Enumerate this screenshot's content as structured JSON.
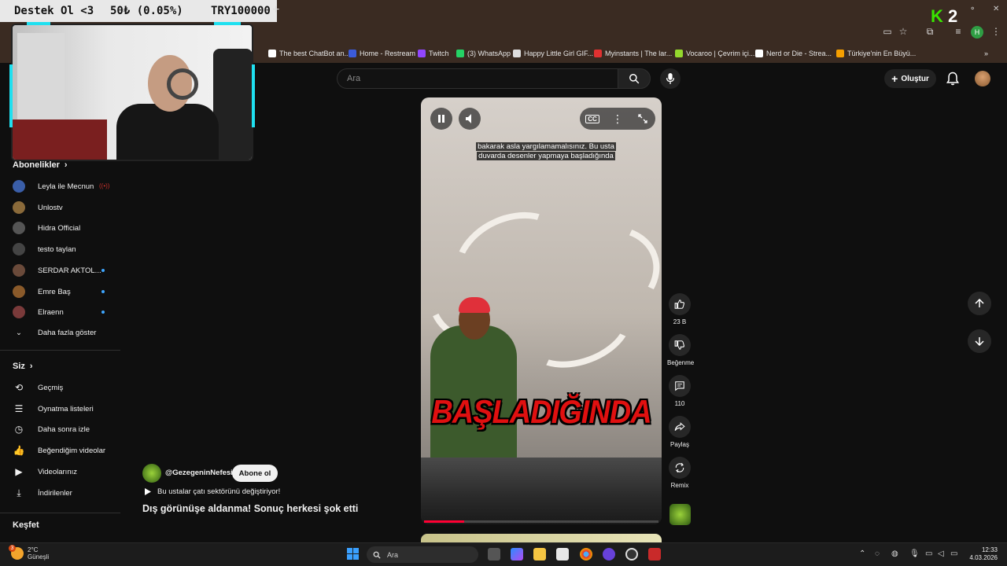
{
  "stream_overlay": {
    "banner_left": "Destek Ol <3",
    "banner_mid": "50₺ (0.05%)",
    "banner_right": "TRY100000",
    "brand_letter": "K",
    "brand_number": "2"
  },
  "bookmarks": [
    {
      "label": "The best ChatBot an...",
      "color": "#ffffff"
    },
    {
      "label": "Home - Restream",
      "color": "#3b5bdb"
    },
    {
      "label": "Twitch",
      "color": "#9146ff"
    },
    {
      "label": "(3) WhatsApp",
      "color": "#25d366"
    },
    {
      "label": "Happy Little Girl GIF...",
      "color": "#dddddd"
    },
    {
      "label": "Myinstants | The lar...",
      "color": "#e03131"
    },
    {
      "label": "Vocaroo | Çevrim içi...",
      "color": "#94d82d"
    },
    {
      "label": "Nerd or Die - Strea...",
      "color": "#ffffff"
    },
    {
      "label": "Türkiye'nin En Büyü...",
      "color": "#f59f00"
    }
  ],
  "header": {
    "search_placeholder": "Ara",
    "create_label": "Oluştur"
  },
  "sidebar": {
    "subscriptions_title": "Abonelikler",
    "subscriptions": [
      {
        "name": "Leyla ile Mecnun",
        "color": "#3a5ea8",
        "badge": "live"
      },
      {
        "name": "Unlostv",
        "color": "#8a6a3a",
        "badge": ""
      },
      {
        "name": "Hidra Official",
        "color": "#555555",
        "badge": ""
      },
      {
        "name": "testo taylan",
        "color": "#444444",
        "badge": ""
      },
      {
        "name": "SERDAR AKTOL...",
        "color": "#6a4a3a",
        "badge": "dot"
      },
      {
        "name": "Emre Baş",
        "color": "#8a5a2a",
        "badge": "dot"
      },
      {
        "name": "Elraenn",
        "color": "#7a3a3a",
        "badge": "dot"
      }
    ],
    "show_more": "Daha fazla göster",
    "you_title": "Siz",
    "you_items": [
      {
        "label": "Geçmiş",
        "icon": "history-icon"
      },
      {
        "label": "Oynatma listeleri",
        "icon": "playlist-icon"
      },
      {
        "label": "Daha sonra izle",
        "icon": "clock-icon"
      },
      {
        "label": "Beğendiğim videolar",
        "icon": "thumb-up-icon"
      },
      {
        "label": "Videolarınız",
        "icon": "video-icon"
      },
      {
        "label": "İndirilenler",
        "icon": "download-icon"
      }
    ],
    "explore_title": "Keşfet"
  },
  "video": {
    "caption_line1": "bakarak asla yargılamamalısınız. Bu usta",
    "caption_line2": "duvarda desenler yapmaya başladığında",
    "overlay_text": "BAŞLADIĞINDA",
    "progress": 0.17,
    "cc_label": "CC"
  },
  "actions": {
    "like_count": "23 B",
    "dislike_label": "Beğenme",
    "comment_count": "110",
    "share_label": "Paylaş",
    "remix_label": "Remix"
  },
  "channel": {
    "name": "@GezegeninNefesi",
    "subscribe_label": "Abone ol",
    "linked_title": "Bu ustalar çatı sektörünü değiştiriyor!",
    "title": "Dış görünüşe aldanma! Sonuç herkesi şok etti"
  },
  "taskbar": {
    "temp": "2°C",
    "weather": "Güneşli",
    "search_label": "Ara",
    "time": "12:33",
    "date": "4.03.2026",
    "badge": "3"
  }
}
